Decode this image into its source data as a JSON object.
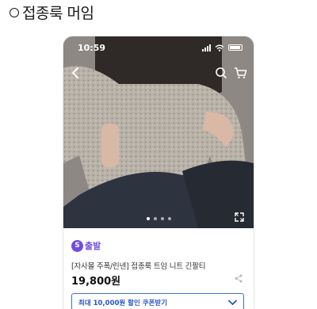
{
  "post": {
    "heading": "접종룩 머임"
  },
  "phone": {
    "status": {
      "time": "10:59"
    },
    "carousel": {
      "total": 4,
      "active_index": 1
    }
  },
  "product": {
    "badge_logo": "S",
    "badge_text": "출발",
    "title": "[자사몰 주폭/린넨] 접종룩 트임 니트 긴팔티",
    "price": "19,800원",
    "coupon": "최대 10,000원 할인 쿠폰받기"
  },
  "colors": {
    "brand": "#6f4ce0",
    "coupon": "#2856c6"
  }
}
